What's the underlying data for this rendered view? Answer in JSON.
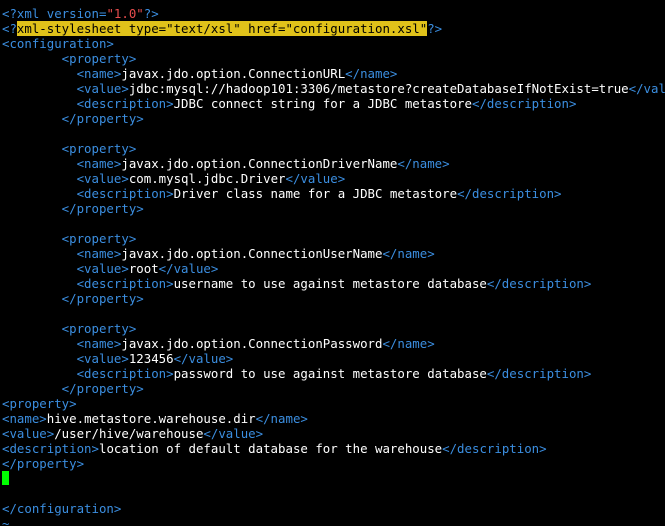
{
  "editor": {
    "lines": [
      [
        {
          "t": "<?",
          "c": "tag"
        },
        {
          "t": "xml version=",
          "c": "tag"
        },
        {
          "t": "\"1.0\"",
          "c": "str"
        },
        {
          "t": "?>",
          "c": "tag"
        }
      ],
      [
        {
          "t": "<?",
          "c": "tag"
        },
        {
          "t": "xml-stylesheet type=\"text/xsl\" href=\"configuration.xsl\"",
          "c": "hl"
        },
        {
          "t": "?>",
          "c": "tag"
        }
      ],
      [
        {
          "t": "<configuration>",
          "c": "tag"
        }
      ],
      [
        {
          "t": "        <property>",
          "c": "tag"
        }
      ],
      [
        {
          "t": "          <name>",
          "c": "tag"
        },
        {
          "t": "javax.jdo.option.ConnectionURL",
          "c": "txt"
        },
        {
          "t": "</name>",
          "c": "tag"
        }
      ],
      [
        {
          "t": "          <value>",
          "c": "tag"
        },
        {
          "t": "jdbc:mysql://hadoop101:3306/metastore?createDatabaseIfNotExist=true",
          "c": "txt"
        },
        {
          "t": "</value>",
          "c": "tag"
        }
      ],
      [
        {
          "t": "          <description>",
          "c": "tag"
        },
        {
          "t": "JDBC connect string for a JDBC metastore",
          "c": "txt"
        },
        {
          "t": "</description>",
          "c": "tag"
        }
      ],
      [
        {
          "t": "        </property>",
          "c": "tag"
        }
      ],
      [],
      [
        {
          "t": "        <property>",
          "c": "tag"
        }
      ],
      [
        {
          "t": "          <name>",
          "c": "tag"
        },
        {
          "t": "javax.jdo.option.ConnectionDriverName",
          "c": "txt"
        },
        {
          "t": "</name>",
          "c": "tag"
        }
      ],
      [
        {
          "t": "          <value>",
          "c": "tag"
        },
        {
          "t": "com.mysql.jdbc.Driver",
          "c": "txt"
        },
        {
          "t": "</value>",
          "c": "tag"
        }
      ],
      [
        {
          "t": "          <description>",
          "c": "tag"
        },
        {
          "t": "Driver class name for a JDBC metastore",
          "c": "txt"
        },
        {
          "t": "</description>",
          "c": "tag"
        }
      ],
      [
        {
          "t": "        </property>",
          "c": "tag"
        }
      ],
      [],
      [
        {
          "t": "        <property>",
          "c": "tag"
        }
      ],
      [
        {
          "t": "          <name>",
          "c": "tag"
        },
        {
          "t": "javax.jdo.option.ConnectionUserName",
          "c": "txt"
        },
        {
          "t": "</name>",
          "c": "tag"
        }
      ],
      [
        {
          "t": "          <value>",
          "c": "tag"
        },
        {
          "t": "root",
          "c": "txt"
        },
        {
          "t": "</value>",
          "c": "tag"
        }
      ],
      [
        {
          "t": "          <description>",
          "c": "tag"
        },
        {
          "t": "username to use against metastore database",
          "c": "txt"
        },
        {
          "t": "</description>",
          "c": "tag"
        }
      ],
      [
        {
          "t": "        </property>",
          "c": "tag"
        }
      ],
      [],
      [
        {
          "t": "        <property>",
          "c": "tag"
        }
      ],
      [
        {
          "t": "          <name>",
          "c": "tag"
        },
        {
          "t": "javax.jdo.option.ConnectionPassword",
          "c": "txt"
        },
        {
          "t": "</name>",
          "c": "tag"
        }
      ],
      [
        {
          "t": "          <value>",
          "c": "tag"
        },
        {
          "t": "123456",
          "c": "txt"
        },
        {
          "t": "</value>",
          "c": "tag"
        }
      ],
      [
        {
          "t": "          <description>",
          "c": "tag"
        },
        {
          "t": "password to use against metastore database",
          "c": "txt"
        },
        {
          "t": "</description>",
          "c": "tag"
        }
      ],
      [
        {
          "t": "        </property>",
          "c": "tag"
        }
      ],
      [
        {
          "t": "<property>",
          "c": "tag"
        }
      ],
      [
        {
          "t": "<name>",
          "c": "tag"
        },
        {
          "t": "hive.metastore.warehouse.dir",
          "c": "txt"
        },
        {
          "t": "</name>",
          "c": "tag"
        }
      ],
      [
        {
          "t": "<value>",
          "c": "tag"
        },
        {
          "t": "/user/hive/warehouse",
          "c": "txt"
        },
        {
          "t": "</value>",
          "c": "tag"
        }
      ],
      [
        {
          "t": "<description>",
          "c": "tag"
        },
        {
          "t": "location of default database for the warehouse",
          "c": "txt"
        },
        {
          "t": "</description>",
          "c": "tag"
        }
      ],
      [
        {
          "t": "</property>",
          "c": "tag"
        }
      ],
      [
        {
          "t": "",
          "c": "cursor"
        }
      ],
      [],
      [
        {
          "t": "</configuration>",
          "c": "tag"
        }
      ],
      [
        {
          "t": "~",
          "c": "tilde"
        }
      ]
    ]
  },
  "colors": {
    "tag": "#3b8ee0",
    "text": "#ffffff",
    "string": "#e84d4d",
    "highlight": "#e0c21a",
    "cursor": "#00ff00",
    "background": "#000000"
  }
}
